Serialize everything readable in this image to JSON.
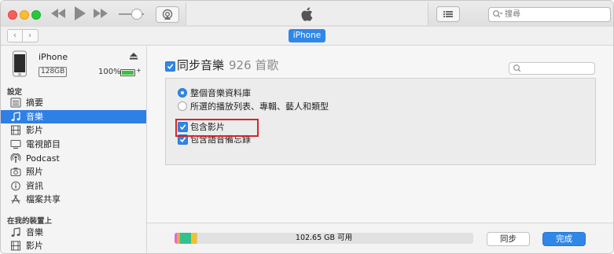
{
  "toolbar": {
    "search_placeholder": "搜尋",
    "device_tab": "iPhone"
  },
  "device": {
    "name": "iPhone",
    "capacity": "128GB",
    "battery": "100%"
  },
  "sidebar": {
    "section_settings": "設定",
    "items": [
      {
        "label": "摘要",
        "icon": "list-icon"
      },
      {
        "label": "音樂",
        "icon": "music-note-icon",
        "selected": true
      },
      {
        "label": "影片",
        "icon": "film-icon"
      },
      {
        "label": "電視節目",
        "icon": "tv-icon"
      },
      {
        "label": "Podcast",
        "icon": "podcast-icon"
      },
      {
        "label": "照片",
        "icon": "camera-icon"
      },
      {
        "label": "資訊",
        "icon": "info-icon"
      },
      {
        "label": "檔案共享",
        "icon": "app-store-icon"
      }
    ],
    "section_on_device": "在我的裝置上",
    "device_items": [
      {
        "label": "音樂",
        "icon": "music-note-icon"
      },
      {
        "label": "影片",
        "icon": "film-icon"
      }
    ]
  },
  "main": {
    "sync_label": "同步音樂",
    "sync_count": "926 首歌",
    "options": {
      "entire_library": "整個音樂資料庫",
      "selected": "所選的播放列表、專輯、藝人和類型",
      "include_videos": "包含影片",
      "include_voice_memos": "包含語音備忘錄"
    }
  },
  "footer": {
    "storage_free": "102.65 GB 可用",
    "storage_usage": [
      {
        "color": "#e36bd0",
        "fraction": 0.009
      },
      {
        "color": "#f0a63c",
        "fraction": 0.009
      },
      {
        "color": "#34c08e",
        "fraction": 0.036
      },
      {
        "color": "#f4c02a",
        "fraction": 0.021
      },
      {
        "color": "#e1e1e1",
        "fraction": 0.925
      }
    ],
    "sync_button": "同步",
    "done_button": "完成"
  },
  "colors": {
    "accent": "#2f87e8",
    "highlight_box": "#d6242d"
  }
}
